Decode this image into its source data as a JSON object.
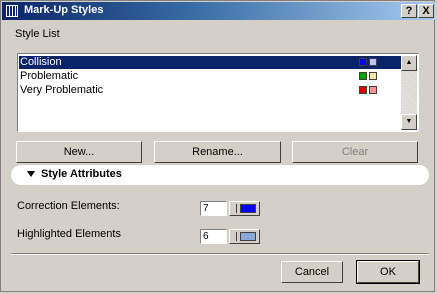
{
  "window": {
    "title": "Mark-Up Styles",
    "help_label": "?",
    "close_label": "X"
  },
  "style_list": {
    "label": "Style List",
    "items": [
      {
        "name": "Collision",
        "selected": true,
        "colors": [
          "#0000ff",
          "#c0c0ff"
        ]
      },
      {
        "name": "Problematic",
        "selected": false,
        "colors": [
          "#00a000",
          "#f0e6a0"
        ]
      },
      {
        "name": "Very Problematic",
        "selected": false,
        "colors": [
          "#e00000",
          "#ff9090"
        ]
      }
    ]
  },
  "buttons": {
    "new": "New...",
    "rename": "Rename...",
    "clear": "Clear"
  },
  "style_attributes": {
    "label": "Style Attributes",
    "correction_label": "Correction Elements:",
    "correction_value": "7",
    "correction_color": "#0000ff",
    "highlighted_label": "Highlighted Elements",
    "highlighted_value": "6",
    "highlighted_color": "#8aa8d8"
  },
  "footer": {
    "cancel": "Cancel",
    "ok": "OK"
  },
  "colors": {
    "selection": "#0a246a",
    "title_gradient_start": "#0a246a",
    "dialog_bg": "#d4d0c8"
  }
}
